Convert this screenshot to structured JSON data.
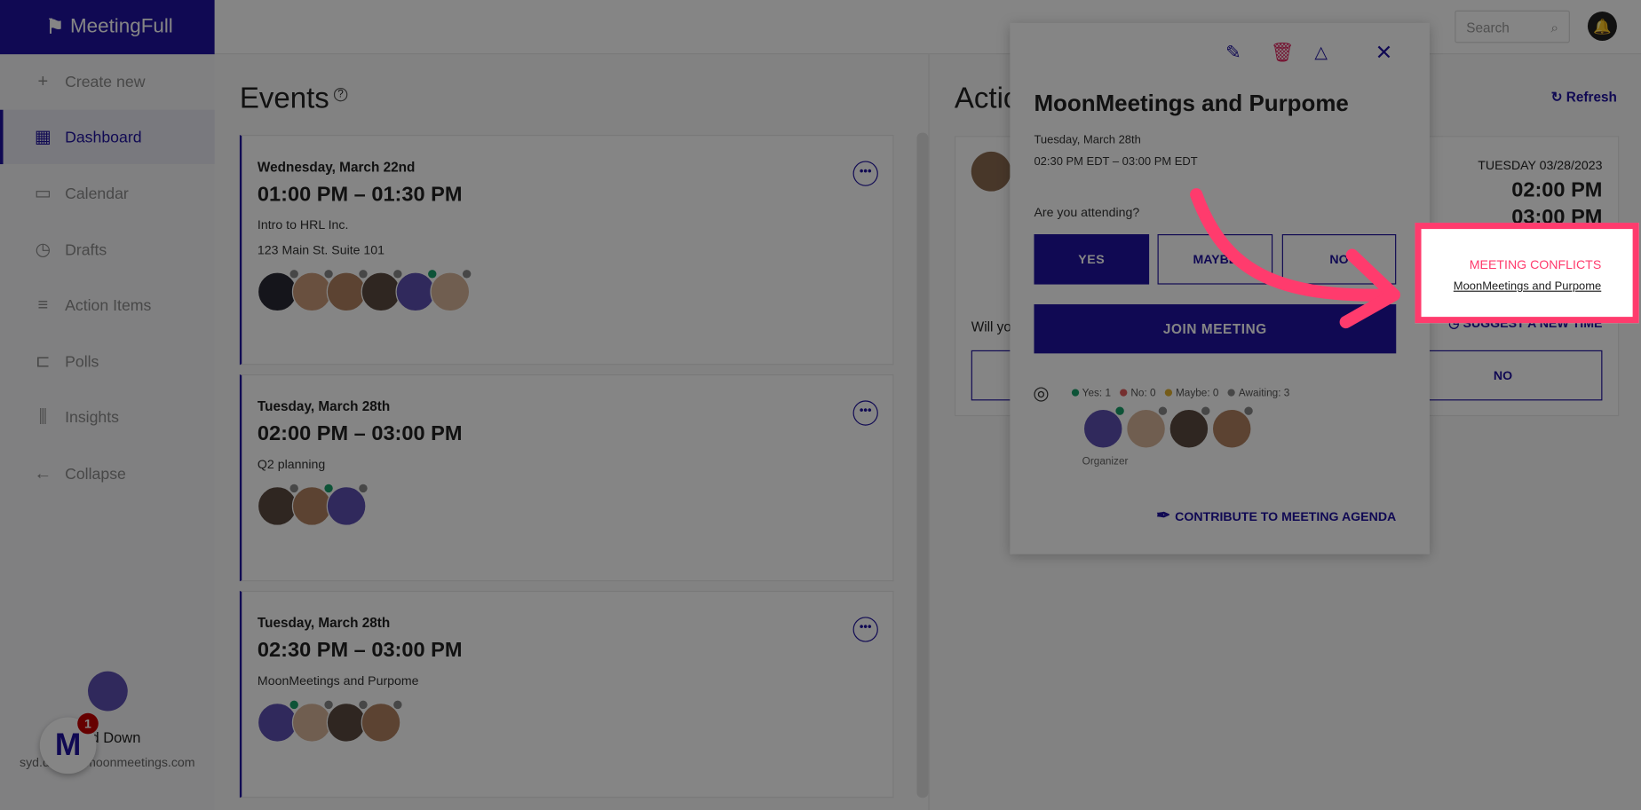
{
  "app": {
    "name": "MeetingFull"
  },
  "topbar": {
    "search_placeholder": "Search"
  },
  "sidebar": {
    "items": [
      {
        "label": "Create new",
        "icon": "plus-icon",
        "glyph": "+"
      },
      {
        "label": "Dashboard",
        "icon": "grid-icon",
        "glyph": "▦",
        "active": true
      },
      {
        "label": "Calendar",
        "icon": "calendar-icon",
        "glyph": "▭"
      },
      {
        "label": "Drafts",
        "icon": "clock-icon",
        "glyph": "◷"
      },
      {
        "label": "Action Items",
        "icon": "list-icon",
        "glyph": "≡"
      },
      {
        "label": "Polls",
        "icon": "ballot-icon",
        "glyph": "⊏"
      },
      {
        "label": "Insights",
        "icon": "bar-chart-icon",
        "glyph": "⫼"
      },
      {
        "label": "Collapse",
        "icon": "arrow-left-icon",
        "glyph": "←"
      }
    ],
    "user": {
      "name": "Syd Down",
      "email": "syd.down@moonmeetings.com"
    },
    "badge_count": "1"
  },
  "events": {
    "title": "Events",
    "help": "?",
    "cards": [
      {
        "date": "Wednesday, March 22nd",
        "time": "01:00 PM – 01:30 PM",
        "lines": [
          "Intro to HRL Inc.",
          "123 Main St. Suite 101"
        ],
        "avatars": [
          [
            "#2a2a35",
            "#888"
          ],
          [
            "#c99a7a",
            "#888"
          ],
          [
            "#b08060",
            "#888"
          ],
          [
            "#5a4a40",
            "#888"
          ],
          [
            "#5d4fb0",
            "#1aa06a"
          ],
          [
            "#d7b49a",
            "#888"
          ]
        ]
      },
      {
        "date": "Tuesday, March 28th",
        "time": "02:00 PM – 03:00 PM",
        "lines": [
          "Q2 planning"
        ],
        "avatars": [
          [
            "#5a4a40",
            "#888"
          ],
          [
            "#b08060",
            "#1aa06a"
          ],
          [
            "#5d4fb0",
            "#888"
          ]
        ]
      },
      {
        "date": "Tuesday, March 28th",
        "time": "02:30 PM – 03:00 PM",
        "lines": [
          "MoonMeetings and Purpome"
        ],
        "avatars": [
          [
            "#5d4fb0",
            "#1aa06a"
          ],
          [
            "#d7b49a",
            "#888"
          ],
          [
            "#5a4a40",
            "#888"
          ],
          [
            "#b08060",
            "#888"
          ]
        ]
      }
    ]
  },
  "actions": {
    "title": "Action Items",
    "refresh": "Refresh",
    "date": "TUESDAY 03/28/2023",
    "start": "02:00 PM",
    "end": "03:00 PM",
    "question": "Will you attend?",
    "suggest": "SUGGEST A NEW TIME",
    "no": "NO"
  },
  "modal": {
    "title": "MoonMeetings and Purpome",
    "date": "Tuesday, March 28th",
    "time": "02:30 PM EDT – 03:00 PM EDT",
    "question": "Are you attending?",
    "yes": "YES",
    "maybe": "MAYBE",
    "no": "NO",
    "join": "JOIN MEETING",
    "stats": [
      {
        "label": "Yes: 1",
        "color": "#1aa06a"
      },
      {
        "label": "No: 0",
        "color": "#e05a5a"
      },
      {
        "label": "Maybe: 0",
        "color": "#e0b030"
      },
      {
        "label": "Awaiting: 3",
        "color": "#888"
      }
    ],
    "attendees": [
      [
        "#5d4fb0",
        "#1aa06a"
      ],
      [
        "#d7b49a",
        "#888"
      ],
      [
        "#5a4a40",
        "#888"
      ],
      [
        "#b08060",
        "#888"
      ]
    ],
    "organizer": "Organizer",
    "contribute": "CONTRIBUTE TO MEETING AGENDA"
  },
  "conflicts": {
    "heading": "MEETING CONFLICTS",
    "link": "MoonMeetings and Purpome"
  },
  "colors": {
    "brand": "#1f13a0",
    "highlight": "#ff3b6d",
    "delete": "#e0245e"
  }
}
